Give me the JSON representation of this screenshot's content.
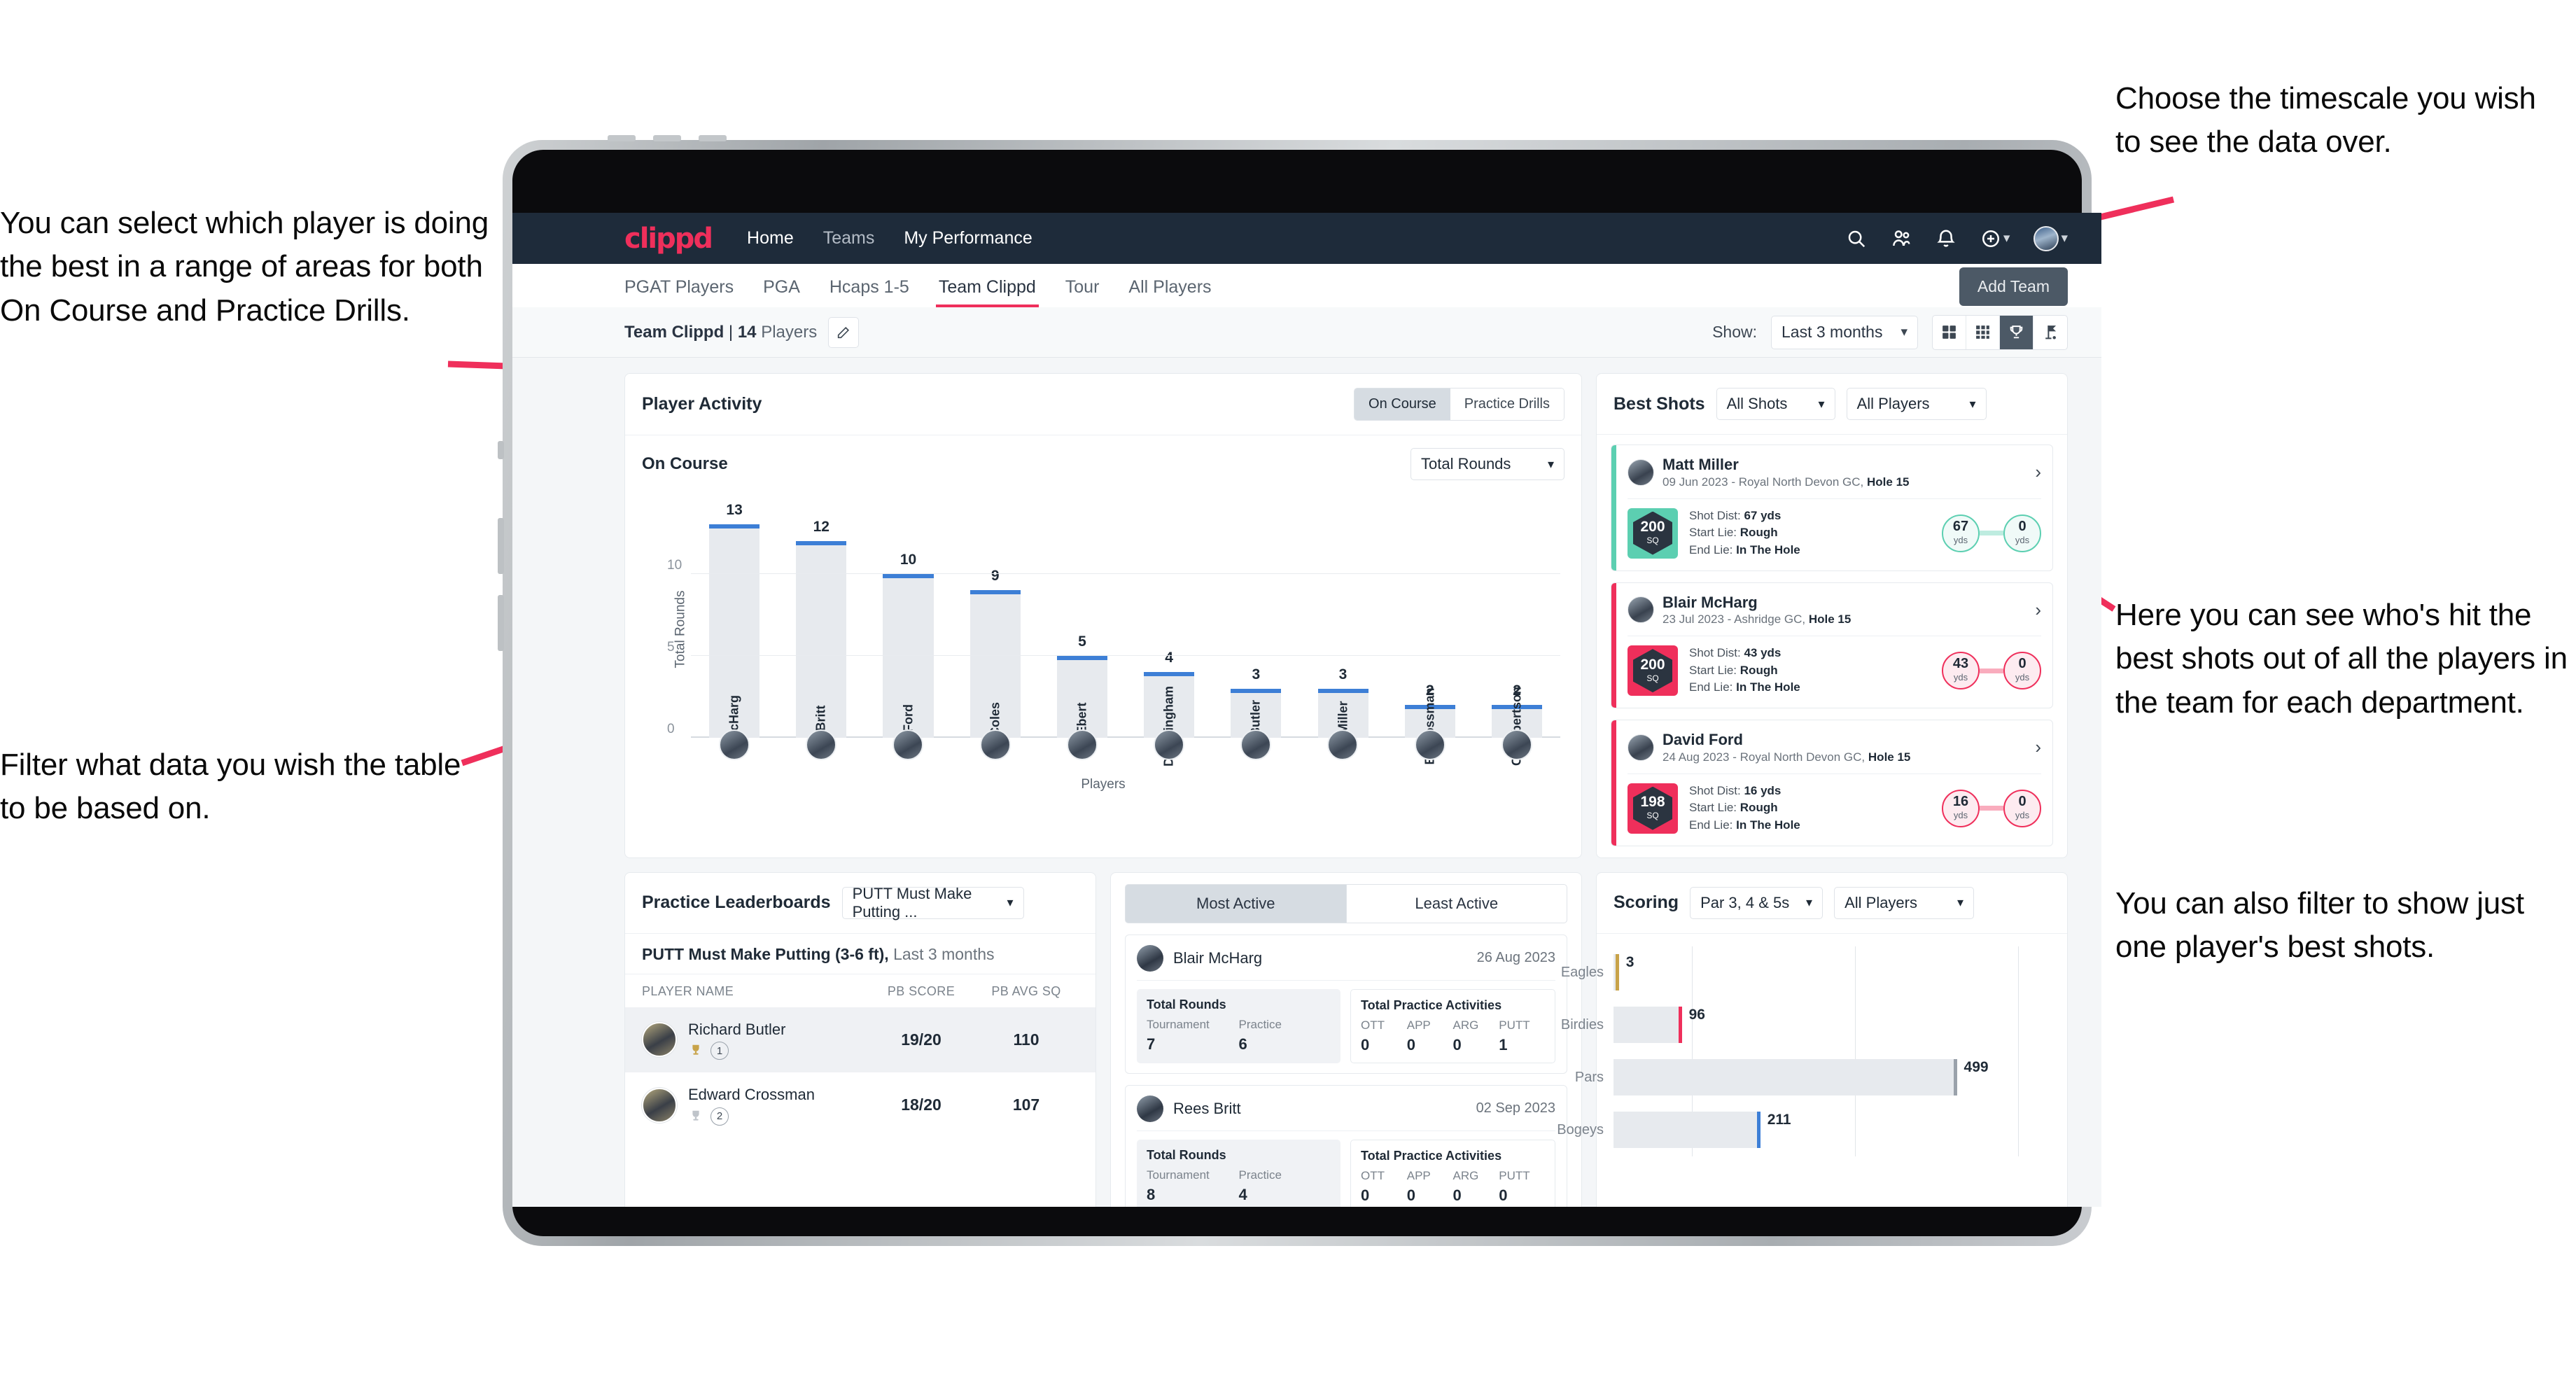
{
  "annotations": {
    "left_top": "You can select which player is doing the best in a range of areas for both On Course and Practice Drills.",
    "left_bottom": "Filter what data you wish the table to be based on.",
    "right_top": "Choose the timescale you wish to see the data over.",
    "right_middle": "Here you can see who's hit the best shots out of all the players in the team for each department.",
    "right_bottom": "You can also filter to show just one player's best shots."
  },
  "colors": {
    "brand_pink": "#ef2f5b",
    "nav_dark": "#1e2b3a",
    "bar_blue": "#3d7fd6",
    "teal": "#5ccfb1",
    "gold": "#c8a349"
  },
  "topnav": {
    "logo": "clippd",
    "links": [
      {
        "label": "Home",
        "active": true
      },
      {
        "label": "Teams",
        "active": false
      },
      {
        "label": "My Performance",
        "active": false
      }
    ],
    "icons": [
      "search-icon",
      "people-icon",
      "bell-icon",
      "plus-circle-icon",
      "avatar"
    ]
  },
  "tabs": [
    {
      "label": "PGAT Players",
      "active": false
    },
    {
      "label": "PGA",
      "active": false
    },
    {
      "label": "Hcaps 1-5",
      "active": false
    },
    {
      "label": "Team Clippd",
      "active": true
    },
    {
      "label": "Tour",
      "active": false
    },
    {
      "label": "All Players",
      "active": false
    }
  ],
  "add_team_label": "Add Team",
  "toolbar": {
    "team_name": "Team Clippd",
    "separator": " | ",
    "player_count": "14",
    "players_word": "Players",
    "show_label": "Show:",
    "timescale_value": "Last 3 months",
    "view_icons": [
      {
        "name": "grid-2x2-icon",
        "active": false
      },
      {
        "name": "grid-3x3-icon",
        "active": false
      },
      {
        "name": "trophy-icon",
        "active": true
      },
      {
        "name": "golf-flag-icon",
        "active": false
      }
    ]
  },
  "player_activity": {
    "title": "Player Activity",
    "segments": [
      {
        "label": "On Course",
        "active": true
      },
      {
        "label": "Practice Drills",
        "active": false
      }
    ],
    "subtitle": "On Course",
    "metric_select": "Total Rounds"
  },
  "chart_data": [
    {
      "type": "bar",
      "title": "Player Activity",
      "xlabel": "Players",
      "ylabel": "Total Rounds",
      "categories": [
        "B. McHarg",
        "R. Britt",
        "D. Ford",
        "J. Coles",
        "E. Ebert",
        "D. Billingham",
        "R. Butler",
        "M. Miller",
        "E. Crossman",
        "C. Robertson"
      ],
      "values": [
        13,
        12,
        10,
        9,
        5,
        4,
        3,
        3,
        2,
        2
      ],
      "ylim": [
        0,
        14
      ],
      "yticks": [
        0,
        5,
        10
      ],
      "grid": true
    },
    {
      "type": "bar",
      "title": "Scoring",
      "orientation": "horizontal",
      "categories": [
        "Eagles",
        "Birdies",
        "Pars",
        "Bogeys"
      ],
      "values": [
        3,
        96,
        499,
        211
      ],
      "colors": [
        "#c8a349",
        "#ef2f5b",
        "#9aa2ab",
        "#3d7fd6"
      ],
      "xlim": [
        0,
        640
      ],
      "grid": true
    }
  ],
  "best_shots": {
    "title": "Best Shots",
    "filter_shots": "All Shots",
    "filter_players": "All Players",
    "shots": [
      {
        "player": "Matt Miller",
        "meta_date": "09 Jun 2023",
        "meta_course": "Royal North Devon GC,",
        "meta_hole": "Hole 15",
        "sq": "200",
        "sq_unit": "SQ",
        "accent": "#5ccfb1",
        "shot_dist_label": "Shot Dist:",
        "shot_dist": "67 yds",
        "start_lie_label": "Start Lie:",
        "start_lie": "Rough",
        "end_lie_label": "End Lie:",
        "end_lie": "In The Hole",
        "from_val": "67",
        "from_unit": "yds",
        "to_val": "0",
        "to_unit": "yds"
      },
      {
        "player": "Blair McHarg",
        "meta_date": "23 Jul 2023",
        "meta_course": "Ashridge GC,",
        "meta_hole": "Hole 15",
        "sq": "200",
        "sq_unit": "SQ",
        "accent": "#ef2f5b",
        "shot_dist_label": "Shot Dist:",
        "shot_dist": "43 yds",
        "start_lie_label": "Start Lie:",
        "start_lie": "Rough",
        "end_lie_label": "End Lie:",
        "end_lie": "In The Hole",
        "from_val": "43",
        "from_unit": "yds",
        "to_val": "0",
        "to_unit": "yds"
      },
      {
        "player": "David Ford",
        "meta_date": "24 Aug 2023",
        "meta_course": "Royal North Devon GC,",
        "meta_hole": "Hole 15",
        "sq": "198",
        "sq_unit": "SQ",
        "accent": "#ef2f5b",
        "shot_dist_label": "Shot Dist:",
        "shot_dist": "16 yds",
        "start_lie_label": "Start Lie:",
        "start_lie": "Rough",
        "end_lie_label": "End Lie:",
        "end_lie": "In The Hole",
        "from_val": "16",
        "from_unit": "yds",
        "to_val": "0",
        "to_unit": "yds"
      }
    ]
  },
  "practice_leaderboards": {
    "title": "Practice Leaderboards",
    "drill_select": "PUTT Must Make Putting ...",
    "subtitle_bold": "PUTT Must Make Putting (3-6 ft),",
    "subtitle_muted": "Last 3 months",
    "columns": [
      "PLAYER NAME",
      "PB SCORE",
      "PB AVG SQ"
    ],
    "rows": [
      {
        "name": "Richard Butler",
        "rank": "1",
        "trophy": "gold",
        "pb_score": "19/20",
        "pb_avg_sq": "110",
        "highlight": true
      },
      {
        "name": "Edward Crossman",
        "rank": "2",
        "trophy": "silver",
        "pb_score": "18/20",
        "pb_avg_sq": "107",
        "highlight": false
      }
    ]
  },
  "activity": {
    "tabs": [
      {
        "label": "Most Active",
        "active": true
      },
      {
        "label": "Least Active",
        "active": false
      }
    ],
    "cards": [
      {
        "name": "Blair McHarg",
        "date": "26 Aug 2023",
        "rounds_title": "Total Rounds",
        "rounds": [
          {
            "key": "Tournament",
            "value": "7"
          },
          {
            "key": "Practice",
            "value": "6"
          }
        ],
        "practice_title": "Total Practice Activities",
        "practice": [
          {
            "key": "OTT",
            "value": "0"
          },
          {
            "key": "APP",
            "value": "0"
          },
          {
            "key": "ARG",
            "value": "0"
          },
          {
            "key": "PUTT",
            "value": "1"
          }
        ]
      },
      {
        "name": "Rees Britt",
        "date": "02 Sep 2023",
        "rounds_title": "Total Rounds",
        "rounds": [
          {
            "key": "Tournament",
            "value": "8"
          },
          {
            "key": "Practice",
            "value": "4"
          }
        ],
        "practice_title": "Total Practice Activities",
        "practice": [
          {
            "key": "OTT",
            "value": "0"
          },
          {
            "key": "APP",
            "value": "0"
          },
          {
            "key": "ARG",
            "value": "0"
          },
          {
            "key": "PUTT",
            "value": "0"
          }
        ]
      }
    ]
  },
  "scoring": {
    "title": "Scoring",
    "filter_par": "Par 3, 4 & 5s",
    "filter_players": "All Players"
  }
}
